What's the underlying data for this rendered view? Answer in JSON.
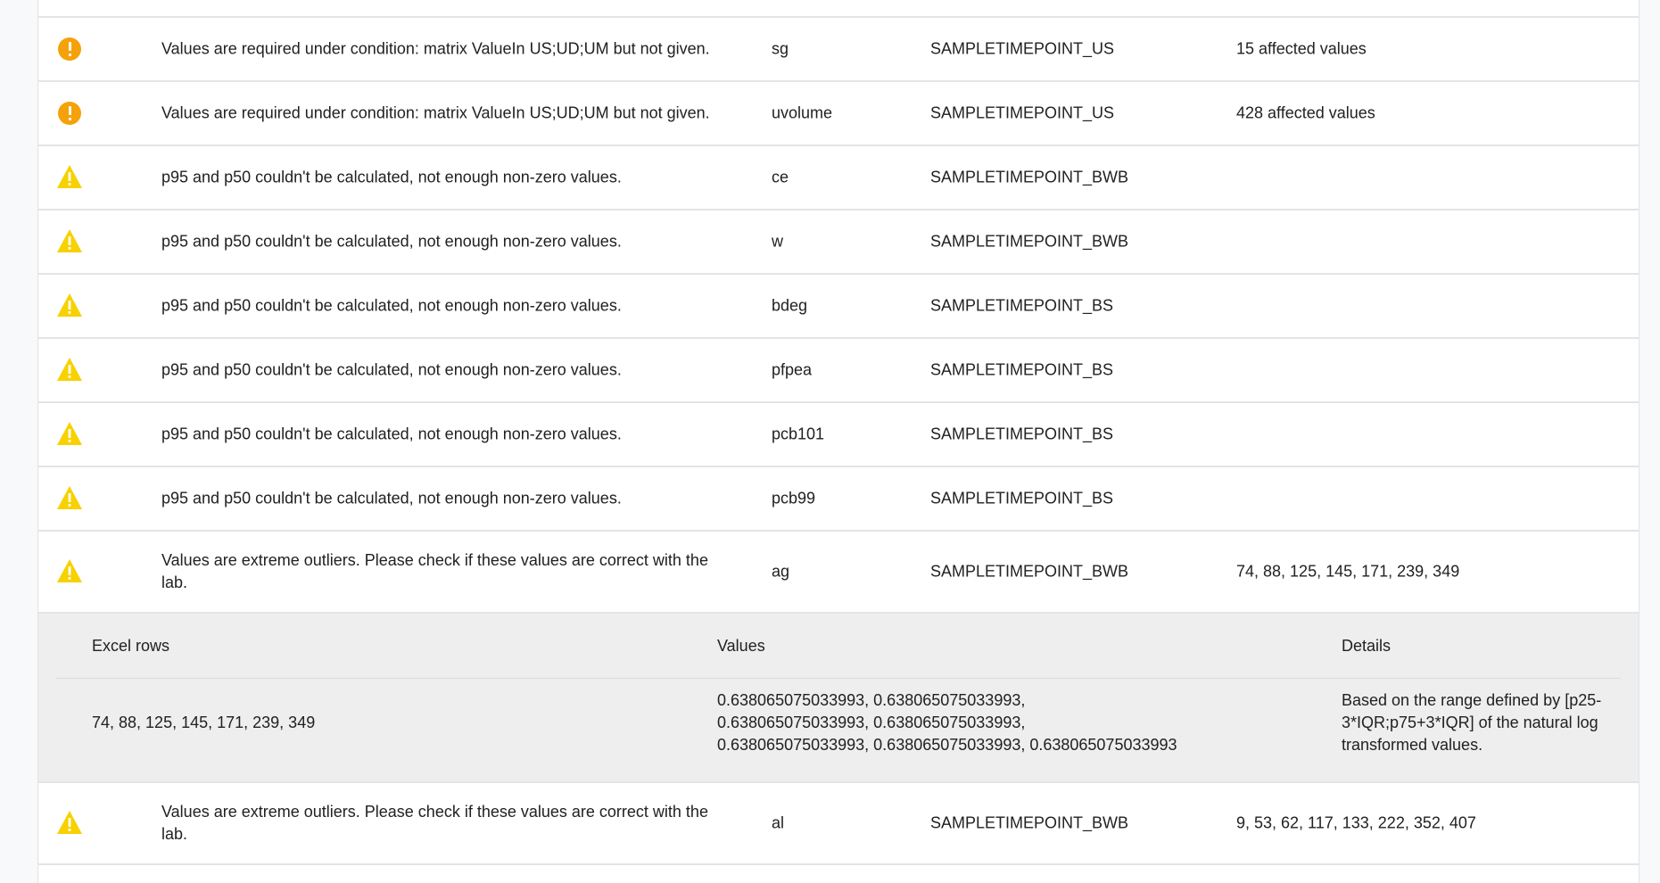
{
  "rows_before": [
    {
      "type": "error",
      "icon": "exclamation-circle-icon",
      "message": "Values are required under condition: matrix ValueIn US;UD;UM but not given.",
      "parameter": "sg",
      "sampletimepoint": "SAMPLETIMEPOINT_US",
      "info": "15 affected values"
    },
    {
      "type": "error",
      "icon": "exclamation-circle-icon",
      "message": "Values are required under condition: matrix ValueIn US;UD;UM but not given.",
      "parameter": "uvolume",
      "sampletimepoint": "SAMPLETIMEPOINT_US",
      "info": "428 affected values"
    },
    {
      "type": "warning",
      "icon": "warning-triangle-icon",
      "message": "p95 and p50 couldn't be calculated, not enough non-zero values.",
      "parameter": "ce",
      "sampletimepoint": "SAMPLETIMEPOINT_BWB",
      "info": ""
    },
    {
      "type": "warning",
      "icon": "warning-triangle-icon",
      "message": "p95 and p50 couldn't be calculated, not enough non-zero values.",
      "parameter": "w",
      "sampletimepoint": "SAMPLETIMEPOINT_BWB",
      "info": ""
    },
    {
      "type": "warning",
      "icon": "warning-triangle-icon",
      "message": "p95 and p50 couldn't be calculated, not enough non-zero values.",
      "parameter": "bdeg",
      "sampletimepoint": "SAMPLETIMEPOINT_BS",
      "info": ""
    },
    {
      "type": "warning",
      "icon": "warning-triangle-icon",
      "message": "p95 and p50 couldn't be calculated, not enough non-zero values.",
      "parameter": "pfpea",
      "sampletimepoint": "SAMPLETIMEPOINT_BS",
      "info": ""
    },
    {
      "type": "warning",
      "icon": "warning-triangle-icon",
      "message": "p95 and p50 couldn't be calculated, not enough non-zero values.",
      "parameter": "pcb101",
      "sampletimepoint": "SAMPLETIMEPOINT_BS",
      "info": ""
    },
    {
      "type": "warning",
      "icon": "warning-triangle-icon",
      "message": "p95 and p50 couldn't be calculated, not enough non-zero values.",
      "parameter": "pcb99",
      "sampletimepoint": "SAMPLETIMEPOINT_BS",
      "info": ""
    },
    {
      "type": "warning",
      "icon": "warning-triangle-icon",
      "message": "Values are extreme outliers. Please check if these values are correct with the lab.",
      "parameter": "ag",
      "sampletimepoint": "SAMPLETIMEPOINT_BWB",
      "info": "74, 88, 125, 145, 171, 239, 349"
    }
  ],
  "detail": {
    "headers": {
      "rows": "Excel rows",
      "values": "Values",
      "details": "Details"
    },
    "excel_rows": "74, 88, 125, 145, 171, 239, 349",
    "values": "0.638065075033993, 0.638065075033993, 0.638065075033993, 0.638065075033993, 0.638065075033993, 0.638065075033993, 0.638065075033993",
    "details": "Based on the range defined by [p25-3*IQR;p75+3*IQR] of the natural log transformed values."
  },
  "rows_after": [
    {
      "type": "warning",
      "icon": "warning-triangle-icon",
      "message": "Values are extreme outliers. Please check if these values are correct with the lab.",
      "parameter": "al",
      "sampletimepoint": "SAMPLETIMEPOINT_BWB",
      "info": "9, 53, 62, 117, 133, 222, 352, 407"
    }
  ],
  "colors": {
    "error": "#f5a20a",
    "warning": "#f7d100",
    "detail_bg": "#eeeeee",
    "divider": "#e4e4e4"
  }
}
